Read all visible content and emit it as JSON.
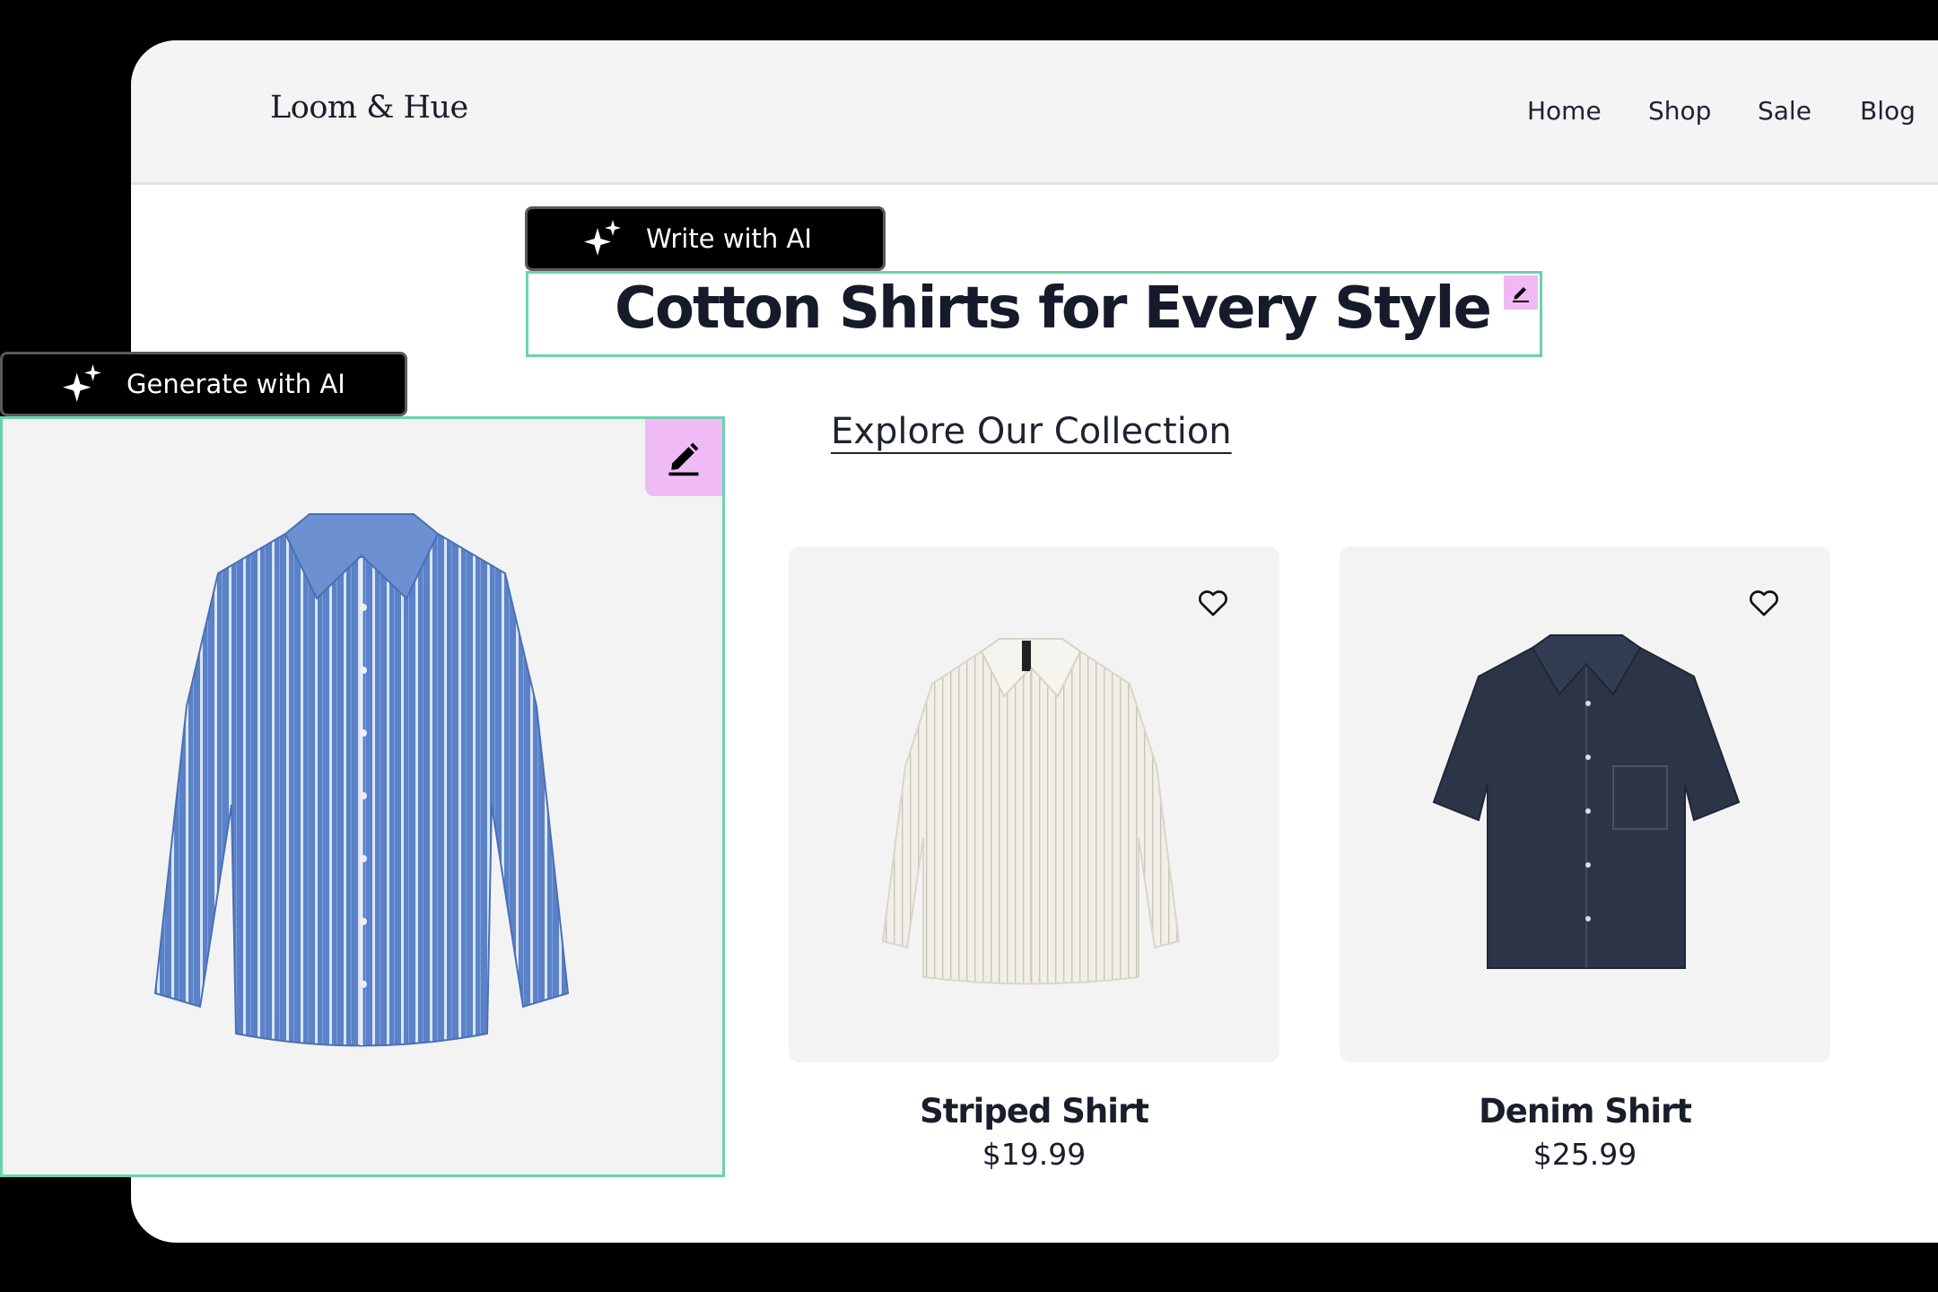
{
  "site": {
    "logo": "Loom & Hue",
    "nav": [
      "Home",
      "Shop",
      "Sale",
      "Blog"
    ]
  },
  "editor": {
    "write_ai_label": "Write with AI",
    "generate_ai_label": "Generate with AI",
    "accent_color": "#6ad3ad",
    "edit_badge_color": "#efbaf5"
  },
  "hero": {
    "headline": "Cotton Shirts for Every Style",
    "cta": "Explore Our Collection"
  },
  "products": [
    {
      "name": "Striped Shirt",
      "price": "$19.99",
      "icon": "heart-icon"
    },
    {
      "name": "Denim Shirt",
      "price": "$25.99",
      "icon": "heart-icon"
    }
  ]
}
